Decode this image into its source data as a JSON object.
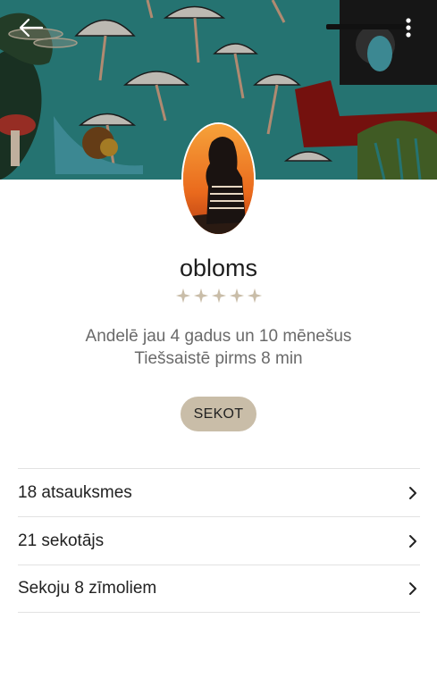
{
  "profile": {
    "username": "obloms",
    "rating_stars": 5,
    "member_since": "Andelē jau 4 gadus un 10 mēnešus",
    "last_online": "Tiešsaistē pirms 8 min"
  },
  "actions": {
    "follow_label": "SEKOT"
  },
  "list": {
    "items": [
      {
        "label": "18 atsauksmes"
      },
      {
        "label": "21 sekotājs"
      },
      {
        "label": "Sekoju 8 zīmoliem"
      }
    ]
  },
  "icons": {
    "back": "arrow-left-icon",
    "menu": "more-vertical-icon",
    "star": "star-icon",
    "chevron": "chevron-right-icon"
  },
  "colors": {
    "cover_teal": "#2e8d8a",
    "follow_button": "#c9bda8",
    "star": "#c9bda8",
    "divider": "#e2e2e2"
  }
}
